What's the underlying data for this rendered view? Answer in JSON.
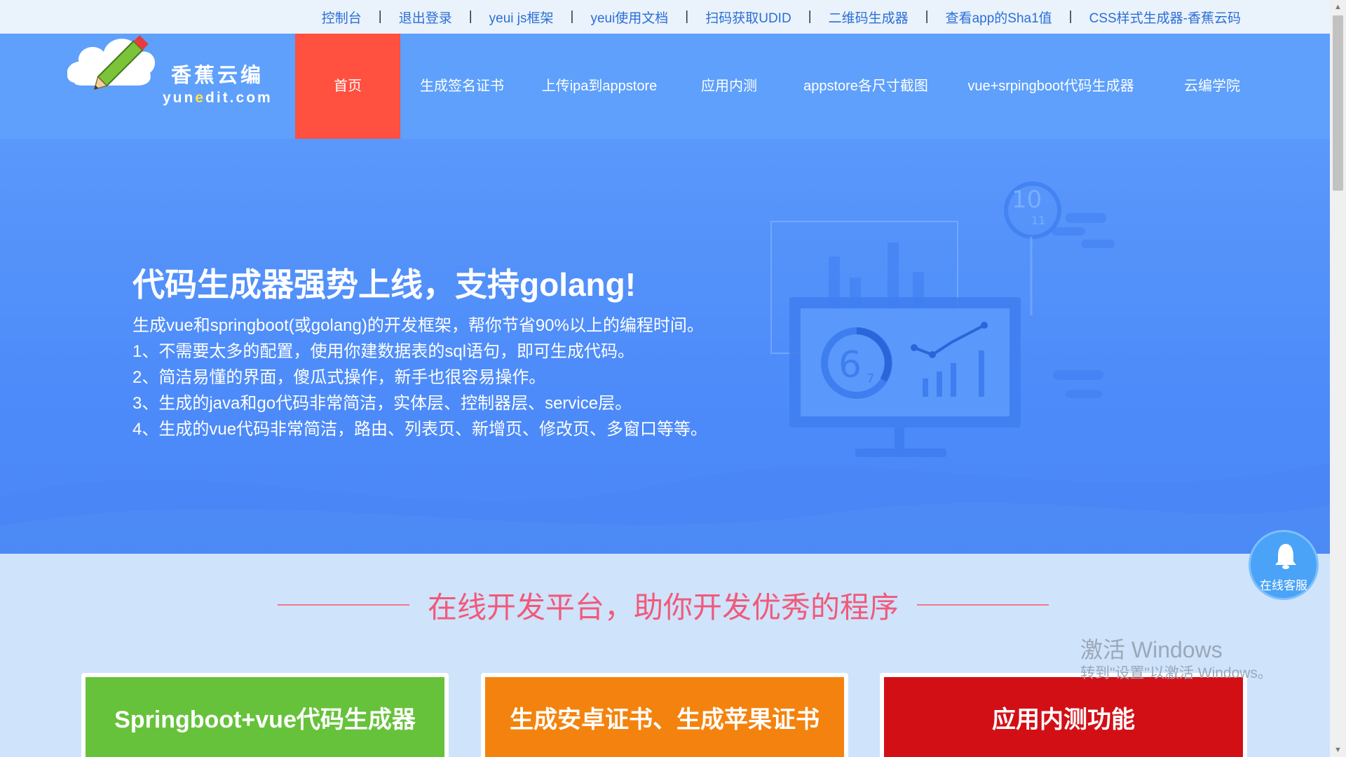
{
  "topbar": {
    "links": [
      "控制台",
      "退出登录",
      "yeui js框架",
      "yeui使用文档",
      "扫码获取UDID",
      "二维码生成器",
      "查看app的Sha1值",
      "CSS样式生成器-香蕉云码"
    ],
    "separator": "|"
  },
  "logo": {
    "cn": "香蕉云编",
    "en_pre": "yun",
    "en_accent": "e",
    "en_post": "dit.com"
  },
  "nav": {
    "items": [
      "首页",
      "生成签名证书",
      "上传ipa到appstore",
      "应用内测",
      "appstore各尺寸截图",
      "vue+srpingboot代码生成器",
      "云编学院"
    ],
    "active_index": 0
  },
  "hero": {
    "title": "代码生成器强势上线，支持golang!",
    "lines": [
      "生成vue和springboot(或golang)的开发框架，帮你节省90%以上的编程时间。",
      "1、不需要太多的配置，使用你建数据表的sql语句，即可生成代码。",
      "2、简洁易懂的界面，傻瓜式操作，新手也很容易操作。",
      "3、生成的java和go代码非常简洁，实体层、控制器层、service层。",
      "4、生成的vue代码非常简洁，路由、列表页、新增页、修改页、多窗口等等。"
    ],
    "illus_gauge_top": "10",
    "illus_gauge_top_sub": "11",
    "illus_gauge_main": "6",
    "illus_gauge_main_sub": "7"
  },
  "section": {
    "title": "在线开发平台，助你开发优秀的程序"
  },
  "cards": [
    {
      "label": "Springboot+vue代码生成器",
      "color": "#66c23a"
    },
    {
      "label": "生成安卓证书、生成苹果证书",
      "color": "#f3830e"
    },
    {
      "label": "应用内测功能",
      "color": "#d30f16"
    }
  ],
  "kefu": {
    "label": "在线客服"
  },
  "watermark": {
    "line1": "激活 Windows",
    "line2": "转到\"设置\"以激活 Windows。"
  },
  "colors": {
    "topbar_bg": "#eaf2fb",
    "nav_bg": "#5ea0fb",
    "nav_active": "#ff5040",
    "hero_bg": "#4e8cfa",
    "section_title": "#f05a7a"
  }
}
